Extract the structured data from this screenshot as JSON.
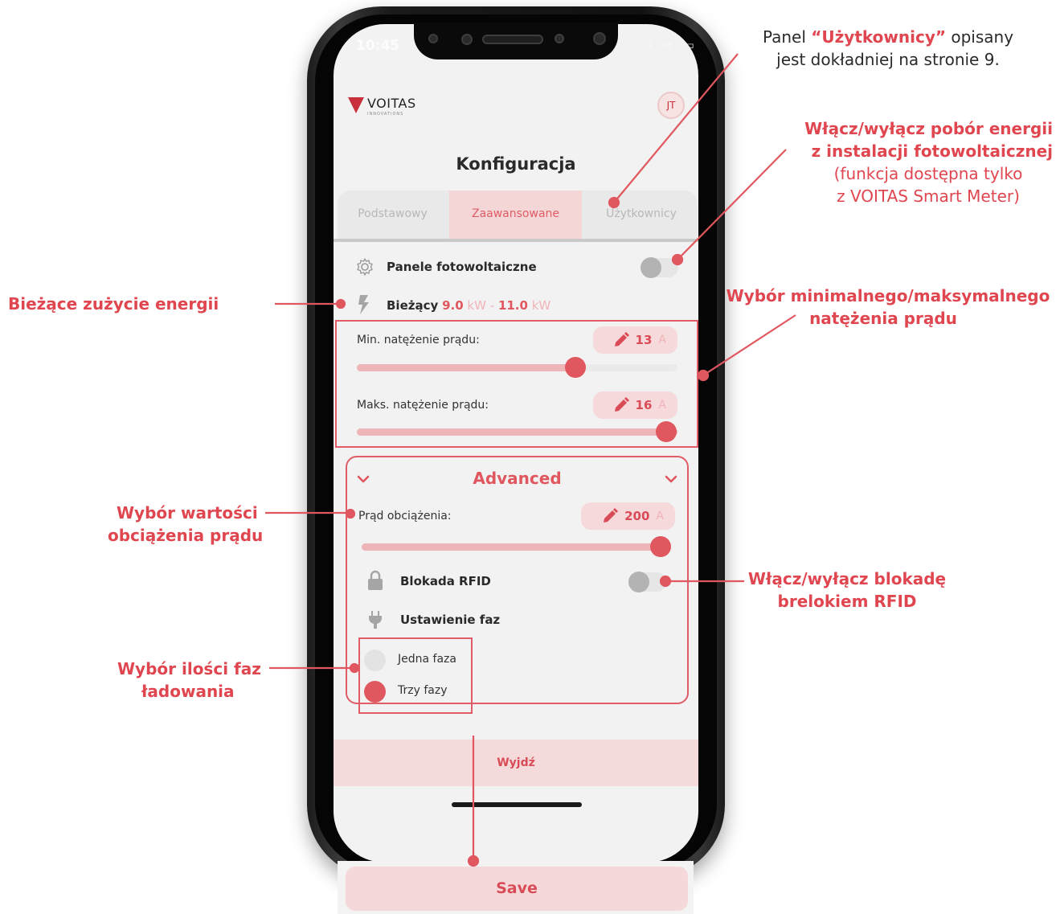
{
  "status_bar": {
    "time": "10:45",
    "right": "..l ≈ ▭"
  },
  "app": {
    "logo_text": "VOITAS",
    "logo_sub": "INNOVATIONS",
    "avatar_initials": "JT",
    "title": "Konfiguracja",
    "tabs": [
      {
        "label": "Podstawowy",
        "active": false
      },
      {
        "label": "Zaawansowane",
        "active": true
      },
      {
        "label": "Użytkownicy",
        "active": false
      }
    ],
    "pv_panels": {
      "label": "Panele fotowoltaiczne",
      "icon": "gear-icon",
      "enabled": false
    },
    "current": {
      "label": "Bieżący",
      "value_from": "9.0",
      "unit_from": "kW",
      "separator": "-",
      "value_to": "11.0",
      "unit_to": "kW",
      "icon": "lightning-icon"
    },
    "min_current": {
      "label": "Min. natężenie prądu:",
      "value": "13",
      "unit": "A",
      "slider_fraction": 0.73
    },
    "max_current": {
      "label": "Maks. natężenie prądu:",
      "value": "16",
      "unit": "A",
      "slider_fraction": 1.0
    },
    "advanced": {
      "title": "Advanced",
      "load_current": {
        "label": "Prąd obciążenia:",
        "value": "200",
        "unit": "A",
        "slider_fraction": 1.0
      },
      "rfid": {
        "label": "Blokada RFID",
        "icon": "lock-icon",
        "enabled": false
      },
      "phases": {
        "label": "Ustawienie faz",
        "icon": "plug-icon",
        "options": [
          {
            "label": "Jedna faza",
            "selected": false
          },
          {
            "label": "Trzy fazy",
            "selected": true
          }
        ]
      }
    },
    "exit_label": "Wyjdź",
    "save_label": "Save"
  },
  "annotations": {
    "users_panel": {
      "prefix": "Panel ",
      "highlight": "“Użytkownicy”",
      "suffix": " opisany",
      "line2": "jest dokładniej na stronie 9."
    },
    "pv_toggle": {
      "line1": "Włącz/wyłącz pobór energii",
      "line2": "z instalacji fotowoltaicznej",
      "line3": "(funkcja dostępna tylko",
      "line4": "z VOITAS Smart Meter)"
    },
    "current_usage": "Bieżące zużycie energii",
    "min_max": {
      "line1": "Wybór minimalnego/maksymalnego",
      "line2": "natężenia prądu"
    },
    "load_value": {
      "line1": "Wybór wartości",
      "line2": "obciążenia prądu"
    },
    "rfid_toggle": {
      "line1": "Włącz/wyłącz blokadę",
      "line2": "brelokiem RFID"
    },
    "phases_select": {
      "line1": "Wybór ilości faz",
      "line2": "ładowania"
    }
  },
  "colors": {
    "accent": "#e0464f",
    "accent_light": "#f5d9da",
    "slider_fill": "#edb5b8",
    "knob": "#e0575f"
  }
}
